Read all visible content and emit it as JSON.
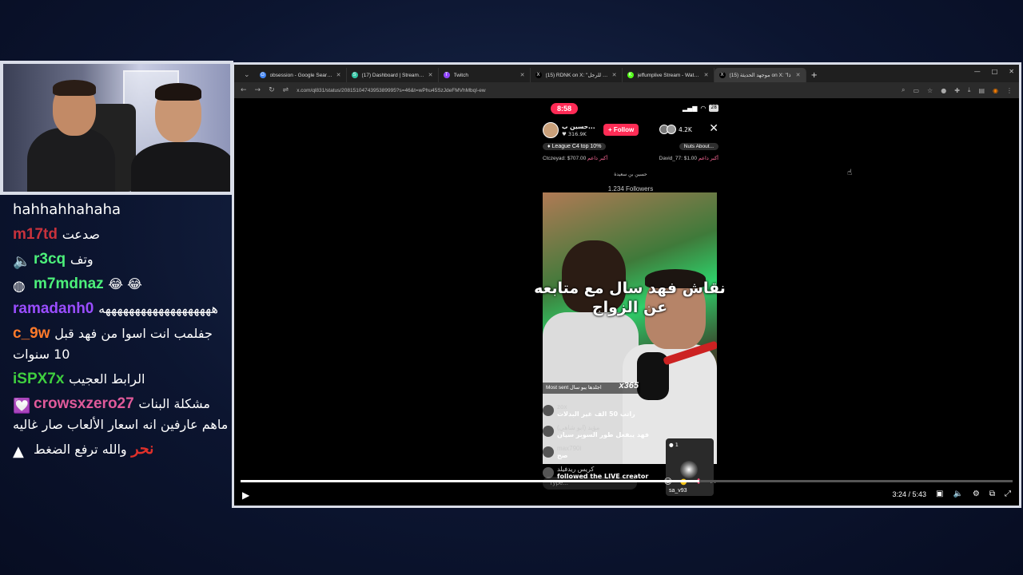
{
  "chat": [
    {
      "user": "",
      "message": "hahhahhahaha",
      "color": "#ffffff",
      "badge": ""
    },
    {
      "user": "m17td",
      "message": "صدعت",
      "color": "#c8323c",
      "badge": ""
    },
    {
      "user": "r3cq",
      "message": "وتف",
      "color": "#4cf07a",
      "badge": "speaker-icon"
    },
    {
      "user": "m7mdnaz",
      "message": "😂 😂",
      "color": "#4cf07a",
      "badge": "avatar-icon"
    },
    {
      "user": "ramadanh0",
      "message": "هههههههههههههههههههه",
      "color": "#9a4dff",
      "badge": ""
    },
    {
      "user": "c_9w",
      "message": "جفلمب انت اسوا من فهد قبل 10 سنوات",
      "color": "#ff7a2a",
      "badge": ""
    },
    {
      "user": "iSPX7x",
      "message": "الرابط العجيب",
      "color": "#3fcf3f",
      "badge": ""
    },
    {
      "user": "crowsxzero27",
      "message": "مشكلة البنات ماهم عارفين انه اسعار الألعاب صار غاليه",
      "color": "#e05a9a",
      "badge": "heart-badge-icon"
    },
    {
      "user": "نحر",
      "message": "والله ترفع الضغط",
      "color": "#e0302a",
      "badge": "triangle-icon"
    }
  ],
  "browser": {
    "tabs": [
      {
        "title": "obsession - Google Search",
        "icon_color": "#4285f4",
        "icon": "G"
      },
      {
        "title": "(17) Dashboard | Streamlabs",
        "icon_color": "#31c3a2",
        "icon": "S"
      },
      {
        "title": "Twitch",
        "icon_color": "#9146ff",
        "icon": "T"
      },
      {
        "title": "(15) RDNK on X: \"المطلوب للرجل",
        "icon_color": "#000000",
        "icon": "X"
      },
      {
        "title": "jeffumplive Stream - Watch Live",
        "icon_color": "#53fc18",
        "icon": "K"
      },
      {
        "title": "(15) موجهد الحديثة on X: \"ذا",
        "icon_color": "#000000",
        "icon": "X"
      }
    ],
    "active_tab": 5,
    "url": "x.com/ql831/status/2081510474395389995?s=46&t=wPhu45SzJdeFMVhMbqI-ew"
  },
  "live": {
    "time": "8:58",
    "battery": "28",
    "host_name": "حسين ب...",
    "host_likes": "316.9K",
    "follow_label": "+ Follow",
    "viewer_count": "4.2K",
    "league": "League C4 top 10%",
    "nuts": "Nuts About...",
    "gift_left_user": "Ctczeyad: $707.00",
    "gift_left_label": "أكبر داعم",
    "gift_right_user": "David_77: $1.00",
    "gift_right_label": "أكبر داعم",
    "host_subtitle": "حسين بن سعيدة",
    "followers": "1.234 Followers",
    "caption": "نقاش فهد سال مع متابعه عن الزواج",
    "most_sent": "Most sent  اجلدها يبو سال",
    "most_sent_count": "x365",
    "comments": [
      {
        "user": "zox",
        "text": "راتب 50 الف غير البدلات"
      },
      {
        "user": "مؤيد (ابو شاهي)",
        "text": "فهد يبفعل طور السوبر سيان"
      },
      {
        "user": "max790i",
        "text": "صح"
      },
      {
        "user": "كريس ريدفيلد",
        "text": "followed the LIVE creator"
      }
    ],
    "mini_cam_count": "1",
    "mini_cam_name": "sa_v93",
    "type_placeholder": "Type..."
  },
  "player": {
    "current": "3:24",
    "duration": "5:43",
    "time_display": "3:24 / 5:43",
    "progress": 0.594
  }
}
